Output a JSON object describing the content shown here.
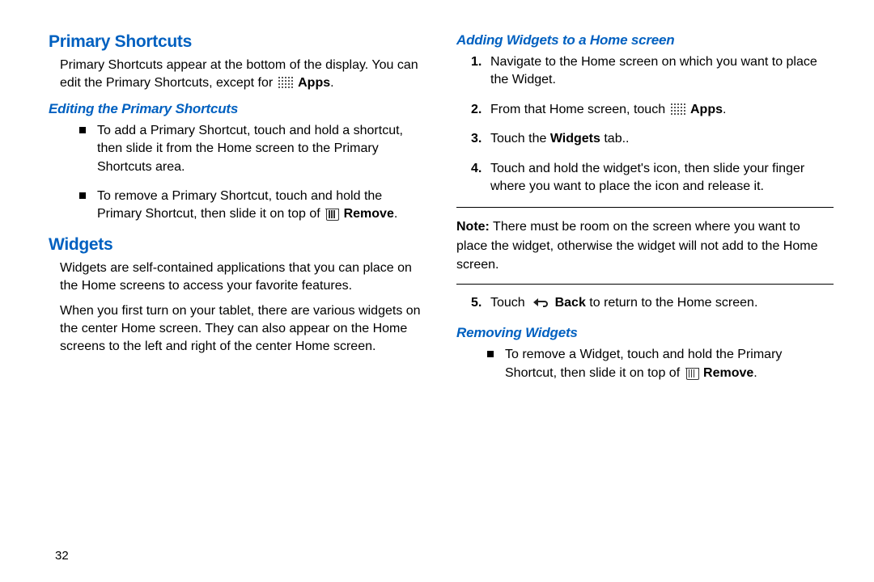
{
  "page_number": "32",
  "left": {
    "h_primary": "Primary Shortcuts",
    "p_primary_intro_a": "Primary Shortcuts appear at the bottom of the display. You can edit the Primary Shortcuts, except for ",
    "p_primary_intro_b": "Apps",
    "p_primary_intro_c": ".",
    "h_editing": "Editing the Primary Shortcuts",
    "bul1": "To add a Primary Shortcut, touch and hold a shortcut, then slide it from the Home screen to the Primary Shortcuts area.",
    "bul2_a": "To remove a Primary Shortcut, touch and hold the Primary Shortcut, then slide it on top of ",
    "bul2_b": "Remove",
    "bul2_c": ".",
    "h_widgets": "Widgets",
    "p_widgets_1": "Widgets are self-contained applications that you can place on the Home screens to access your favorite features.",
    "p_widgets_2": "When you first turn on your tablet, there are various widgets on the center Home screen. They can also appear on the Home screens to the left and right of the center Home screen."
  },
  "right": {
    "h_adding": "Adding Widgets to a Home screen",
    "step1": "Navigate to the Home screen on which you want to place the Widget.",
    "step2_a": "From that Home screen, touch ",
    "step2_b": "Apps",
    "step2_c": ".",
    "step3_a": "Touch the ",
    "step3_b": "Widgets",
    "step3_c": " tab.",
    "step4": "Touch and hold the widget's icon, then slide your finger where you want to place the icon and release it.",
    "note_label": "Note:",
    "note_text": " There must be room on the screen where you want to place the widget, otherwise the widget will not add to the Home screen.",
    "step5_a": "Touch ",
    "step5_b": "Back",
    "step5_c": " to return to the Home screen.",
    "h_removing": "Removing Widgets",
    "rem_a": "To remove a Widget, touch and hold the Primary Shortcut, then slide it on top of ",
    "rem_b": "Remove",
    "rem_c": "."
  }
}
